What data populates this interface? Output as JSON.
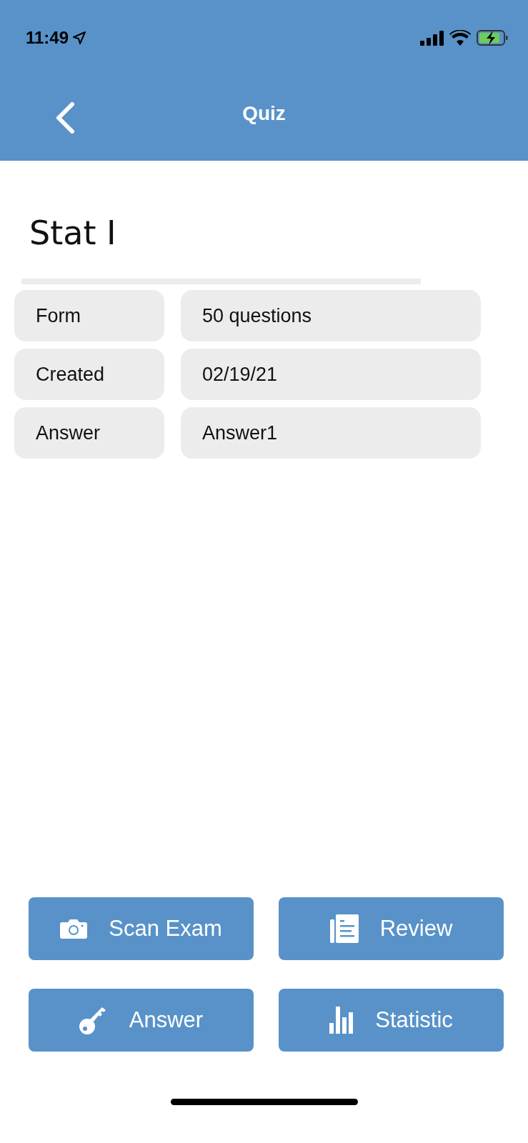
{
  "status_bar": {
    "time": "11:49"
  },
  "nav": {
    "title": "Quiz"
  },
  "quiz": {
    "name": "Stat I"
  },
  "details": [
    {
      "label": "Form",
      "value": "50 questions"
    },
    {
      "label": "Created",
      "value": "02/19/21"
    },
    {
      "label": "Answer",
      "value": "Answer1"
    }
  ],
  "actions": [
    {
      "kind": "camera",
      "label": "Scan Exam"
    },
    {
      "kind": "document",
      "label": "Review"
    },
    {
      "kind": "key",
      "label": "Answer"
    },
    {
      "kind": "chart",
      "label": "Statistic"
    }
  ]
}
